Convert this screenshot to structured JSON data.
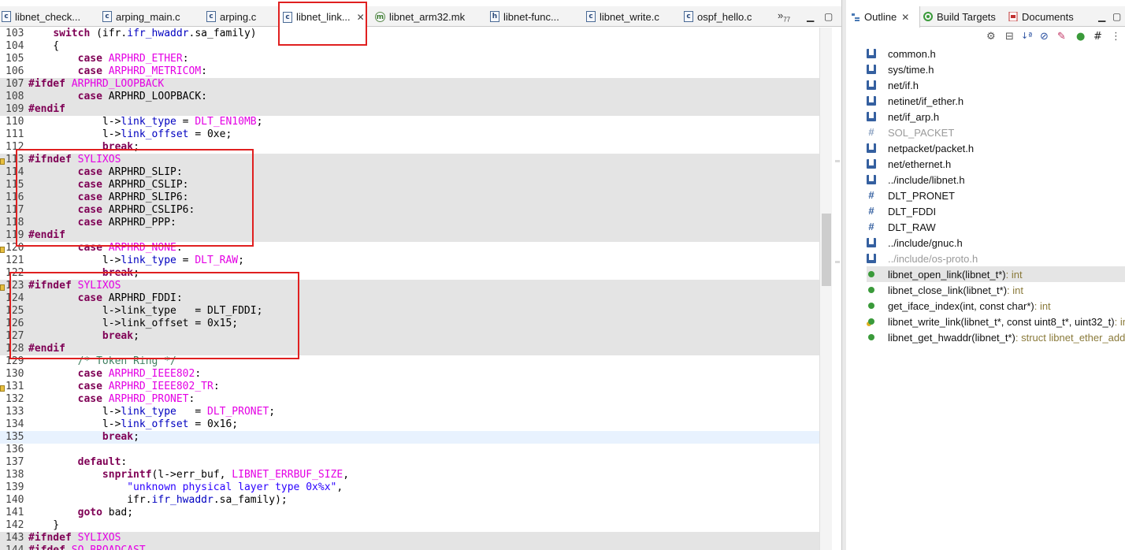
{
  "editor_tabs": [
    {
      "label": "libnet_check...",
      "icon": "c-file-icon"
    },
    {
      "label": "arping_main.c",
      "icon": "c-file-icon"
    },
    {
      "label": "arping.c",
      "icon": "c-file-icon"
    },
    {
      "label": "libnet_link...",
      "icon": "c-file-icon",
      "close": "✕"
    },
    {
      "label": "libnet_arm32.mk",
      "icon": "makefile-icon"
    },
    {
      "label": "libnet-func...",
      "icon": "h-file-icon"
    },
    {
      "label": "libnet_write.c",
      "icon": "c-file-icon"
    },
    {
      "label": "ospf_hello.c",
      "icon": "c-file-icon"
    }
  ],
  "tab_overflow": {
    "glyph": "»",
    "count": "77"
  },
  "code_lines": [
    {
      "n": "103",
      "segs": [
        [
          "    ",
          ""
        ],
        [
          "switch",
          "kw"
        ],
        [
          " (ifr.",
          ""
        ],
        [
          "ifr_hwaddr",
          "fld"
        ],
        [
          ".sa_family)",
          ""
        ]
      ]
    },
    {
      "n": "104",
      "segs": [
        [
          "    {",
          ""
        ]
      ]
    },
    {
      "n": "105",
      "segs": [
        [
          "        ",
          ""
        ],
        [
          "case",
          "kw"
        ],
        [
          " ",
          ""
        ],
        [
          "ARPHRD_ETHER",
          "mac"
        ],
        [
          ":",
          ""
        ]
      ]
    },
    {
      "n": "106",
      "segs": [
        [
          "        ",
          ""
        ],
        [
          "case",
          "kw"
        ],
        [
          " ",
          ""
        ],
        [
          "ARPHRD_METRICOM",
          "mac"
        ],
        [
          ":",
          ""
        ]
      ]
    },
    {
      "n": "107",
      "inactive": true,
      "segs": [
        [
          "#ifdef",
          "pp"
        ],
        [
          " ",
          ""
        ],
        [
          "ARPHRD_LOOPBACK",
          "mac"
        ]
      ]
    },
    {
      "n": "108",
      "inactive": true,
      "segs": [
        [
          "        ",
          ""
        ],
        [
          "case",
          "kw"
        ],
        [
          " ARPHRD_LOOPBACK:",
          ""
        ]
      ]
    },
    {
      "n": "109",
      "inactive": true,
      "segs": [
        [
          "#endif",
          "pp"
        ]
      ]
    },
    {
      "n": "110",
      "segs": [
        [
          "            l->",
          ""
        ],
        [
          "link_type",
          "fld"
        ],
        [
          " = ",
          ""
        ],
        [
          "DLT_EN10MB",
          "mac"
        ],
        [
          ";",
          ""
        ]
      ]
    },
    {
      "n": "111",
      "segs": [
        [
          "            l->",
          ""
        ],
        [
          "link_offset",
          "fld"
        ],
        [
          " = 0xe;",
          ""
        ]
      ]
    },
    {
      "n": "112",
      "segs": [
        [
          "            ",
          ""
        ],
        [
          "break",
          "kw"
        ],
        [
          ";",
          ""
        ]
      ]
    },
    {
      "n": "113",
      "inactive": true,
      "segs": [
        [
          "#ifndef",
          "pp"
        ],
        [
          " ",
          ""
        ],
        [
          "SYLIXOS",
          "mac"
        ]
      ]
    },
    {
      "n": "114",
      "inactive": true,
      "segs": [
        [
          "        ",
          ""
        ],
        [
          "case",
          "kw"
        ],
        [
          " ARPHRD_SLIP:",
          ""
        ]
      ]
    },
    {
      "n": "115",
      "inactive": true,
      "segs": [
        [
          "        ",
          ""
        ],
        [
          "case",
          "kw"
        ],
        [
          " ARPHRD_CSLIP:",
          ""
        ]
      ]
    },
    {
      "n": "116",
      "inactive": true,
      "segs": [
        [
          "        ",
          ""
        ],
        [
          "case",
          "kw"
        ],
        [
          " ARPHRD_SLIP6:",
          ""
        ]
      ]
    },
    {
      "n": "117",
      "inactive": true,
      "segs": [
        [
          "        ",
          ""
        ],
        [
          "case",
          "kw"
        ],
        [
          " ARPHRD_CSLIP6:",
          ""
        ]
      ]
    },
    {
      "n": "118",
      "inactive": true,
      "segs": [
        [
          "        ",
          ""
        ],
        [
          "case",
          "kw"
        ],
        [
          " ARPHRD_PPP:",
          ""
        ]
      ]
    },
    {
      "n": "119",
      "inactive": true,
      "segs": [
        [
          "#endif",
          "pp"
        ]
      ]
    },
    {
      "n": "120",
      "segs": [
        [
          "        ",
          ""
        ],
        [
          "case",
          "kw"
        ],
        [
          " ",
          ""
        ],
        [
          "ARPHRD_NONE",
          "mac"
        ],
        [
          ":",
          ""
        ]
      ]
    },
    {
      "n": "121",
      "segs": [
        [
          "            l->",
          ""
        ],
        [
          "link_type",
          "fld"
        ],
        [
          " = ",
          ""
        ],
        [
          "DLT_RAW",
          "mac"
        ],
        [
          ";",
          ""
        ]
      ]
    },
    {
      "n": "122",
      "segs": [
        [
          "            ",
          ""
        ],
        [
          "break",
          "kw"
        ],
        [
          ";",
          ""
        ]
      ]
    },
    {
      "n": "123",
      "inactive": true,
      "segs": [
        [
          "#ifndef",
          "pp"
        ],
        [
          " ",
          ""
        ],
        [
          "SYLIXOS",
          "mac"
        ]
      ]
    },
    {
      "n": "124",
      "inactive": true,
      "segs": [
        [
          "        ",
          ""
        ],
        [
          "case",
          "kw"
        ],
        [
          " ARPHRD_FDDI:",
          ""
        ]
      ]
    },
    {
      "n": "125",
      "inactive": true,
      "segs": [
        [
          "            l->link_type   = DLT_FDDI;",
          ""
        ]
      ]
    },
    {
      "n": "126",
      "inactive": true,
      "segs": [
        [
          "            l->link_offset = 0x15;",
          ""
        ]
      ]
    },
    {
      "n": "127",
      "inactive": true,
      "segs": [
        [
          "            ",
          ""
        ],
        [
          "break",
          "kw"
        ],
        [
          ";",
          ""
        ]
      ]
    },
    {
      "n": "128",
      "inactive": true,
      "segs": [
        [
          "#endif",
          "pp"
        ]
      ]
    },
    {
      "n": "129",
      "segs": [
        [
          "        ",
          ""
        ],
        [
          "/* Token Ring */",
          "cmt"
        ]
      ]
    },
    {
      "n": "130",
      "segs": [
        [
          "        ",
          ""
        ],
        [
          "case",
          "kw"
        ],
        [
          " ",
          ""
        ],
        [
          "ARPHRD_IEEE802",
          "mac"
        ],
        [
          ":",
          ""
        ]
      ]
    },
    {
      "n": "131",
      "segs": [
        [
          "        ",
          ""
        ],
        [
          "case",
          "kw"
        ],
        [
          " ",
          ""
        ],
        [
          "ARPHRD_IEEE802_TR",
          "mac"
        ],
        [
          ":",
          ""
        ]
      ]
    },
    {
      "n": "132",
      "segs": [
        [
          "        ",
          ""
        ],
        [
          "case",
          "kw"
        ],
        [
          " ",
          ""
        ],
        [
          "ARPHRD_PRONET",
          "mac"
        ],
        [
          ":",
          ""
        ]
      ]
    },
    {
      "n": "133",
      "segs": [
        [
          "            l->",
          ""
        ],
        [
          "link_type",
          "fld"
        ],
        [
          "   = ",
          ""
        ],
        [
          "DLT_PRONET",
          "mac"
        ],
        [
          ";",
          ""
        ]
      ]
    },
    {
      "n": "134",
      "segs": [
        [
          "            l->",
          ""
        ],
        [
          "link_offset",
          "fld"
        ],
        [
          " = 0x16;",
          ""
        ]
      ]
    },
    {
      "n": "135",
      "current": true,
      "segs": [
        [
          "            ",
          ""
        ],
        [
          "break",
          "kw"
        ],
        [
          ";",
          ""
        ]
      ]
    },
    {
      "n": "136",
      "segs": [
        [
          "",
          ""
        ]
      ]
    },
    {
      "n": "137",
      "segs": [
        [
          "        ",
          ""
        ],
        [
          "default",
          "kw"
        ],
        [
          ":",
          ""
        ]
      ]
    },
    {
      "n": "138",
      "segs": [
        [
          "            ",
          ""
        ],
        [
          "snprintf",
          "kw"
        ],
        [
          "(l->err_buf, ",
          ""
        ],
        [
          "LIBNET_ERRBUF_SIZE",
          "mac"
        ],
        [
          ",",
          ""
        ]
      ]
    },
    {
      "n": "139",
      "segs": [
        [
          "                ",
          ""
        ],
        [
          "\"unknown physical layer type 0x%x\"",
          "str"
        ],
        [
          ",",
          ""
        ]
      ]
    },
    {
      "n": "140",
      "segs": [
        [
          "                ifr.",
          ""
        ],
        [
          "ifr_hwaddr",
          "fld"
        ],
        [
          ".sa_family);",
          ""
        ]
      ]
    },
    {
      "n": "141",
      "segs": [
        [
          "        ",
          ""
        ],
        [
          "goto",
          "kw"
        ],
        [
          " bad;",
          ""
        ]
      ]
    },
    {
      "n": "142",
      "segs": [
        [
          "    }",
          ""
        ]
      ]
    },
    {
      "n": "143",
      "inactive": true,
      "segs": [
        [
          "#ifndef",
          "pp"
        ],
        [
          " ",
          ""
        ],
        [
          "SYLIXOS",
          "mac"
        ]
      ]
    },
    {
      "n": "144",
      "inactive": true,
      "segs": [
        [
          "#ifdef",
          "pp"
        ],
        [
          " ",
          ""
        ],
        [
          "SO_BROADCAST",
          "mac"
        ]
      ]
    }
  ],
  "outline": {
    "tabs": [
      {
        "label": "Outline",
        "icon": "outline-icon",
        "close": "✕"
      },
      {
        "label": "Build Targets",
        "icon": "build-targets-icon"
      },
      {
        "label": "Documents",
        "icon": "pdf-document-icon"
      }
    ],
    "items": [
      {
        "label": "common.h",
        "type": "",
        "icon": "include"
      },
      {
        "label": "sys/time.h",
        "type": "",
        "icon": "include"
      },
      {
        "label": "net/if.h",
        "type": "",
        "icon": "include"
      },
      {
        "label": "netinet/if_ether.h",
        "type": "",
        "icon": "include"
      },
      {
        "label": "net/if_arp.h",
        "type": "",
        "icon": "include"
      },
      {
        "label": "SOL_PACKET",
        "type": "",
        "icon": "macro-disabled",
        "disabled": true
      },
      {
        "label": "netpacket/packet.h",
        "type": "",
        "icon": "include"
      },
      {
        "label": "net/ethernet.h",
        "type": "",
        "icon": "include"
      },
      {
        "label": "../include/libnet.h",
        "type": "",
        "icon": "include"
      },
      {
        "label": "DLT_PRONET",
        "type": "",
        "icon": "macro"
      },
      {
        "label": "DLT_FDDI",
        "type": "",
        "icon": "macro"
      },
      {
        "label": "DLT_RAW",
        "type": "",
        "icon": "macro"
      },
      {
        "label": "../include/gnuc.h",
        "type": "",
        "icon": "include"
      },
      {
        "label": "../include/os-proto.h",
        "type": "",
        "icon": "include",
        "disabled": true
      },
      {
        "label": "libnet_open_link(libnet_t*)",
        "type": " : int",
        "icon": "func",
        "selected": true
      },
      {
        "label": "libnet_close_link(libnet_t*)",
        "type": " : int",
        "icon": "func"
      },
      {
        "label": "get_iface_index(int, const char*)",
        "type": " : int",
        "icon": "func-static"
      },
      {
        "label": "libnet_write_link(libnet_t*, const uint8_t*, uint32_t)",
        "type": " : int",
        "icon": "func-warn"
      },
      {
        "label": "libnet_get_hwaddr(libnet_t*)",
        "type": " : struct libnet_ether_addr",
        "icon": "func"
      }
    ]
  },
  "colors": {
    "highlight_box": "#e02020",
    "inactive_bg": "#e4e4e4",
    "keyword": "#7f0055",
    "macro": "#e400e4"
  }
}
